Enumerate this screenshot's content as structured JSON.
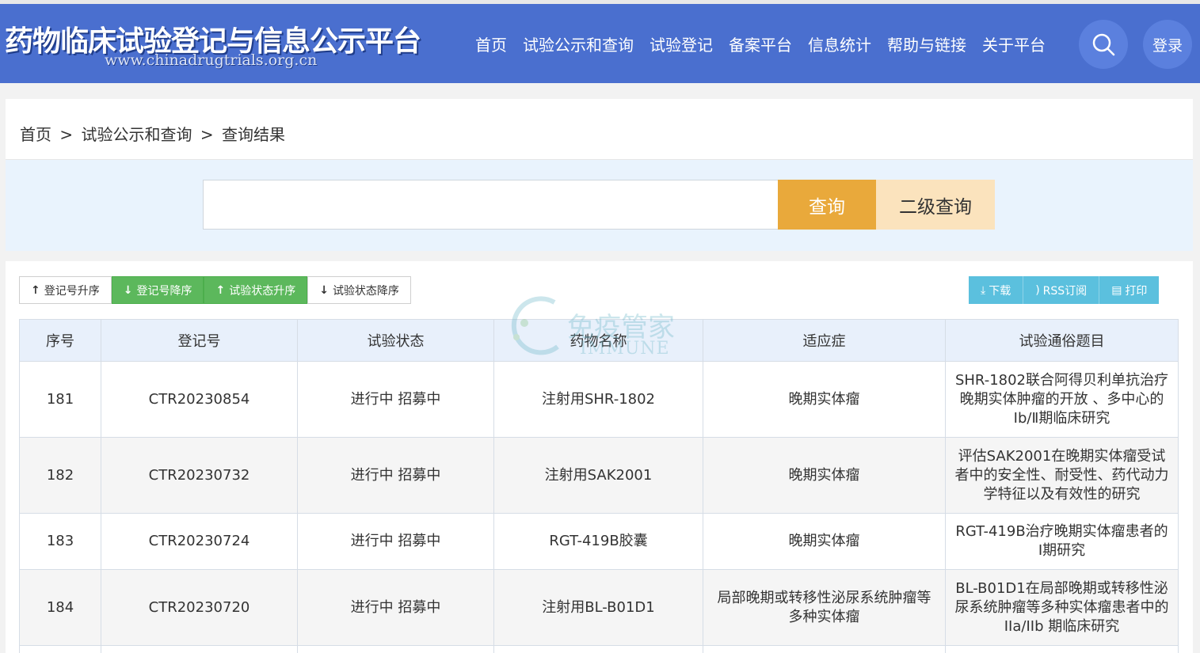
{
  "header": {
    "title": "药物临床试验登记与信息公示平台",
    "url": "www.chinadrugtrials.org.cn",
    "nav": [
      "首页",
      "试验公示和查询",
      "试验登记",
      "备案平台",
      "信息统计",
      "帮助与链接",
      "关于平台"
    ],
    "login_label": "登录"
  },
  "breadcrumb": {
    "items": [
      "首页",
      ">",
      "试验公示和查询",
      ">",
      "查询结果"
    ]
  },
  "search": {
    "value": "",
    "query_label": "查询",
    "secondary_label": "二级查询"
  },
  "sort": {
    "buttons": [
      {
        "arrow": "↑",
        "label": "登记号升序"
      },
      {
        "arrow": "↓",
        "label": "登记号降序"
      },
      {
        "arrow": "↑",
        "label": "试验状态升序"
      },
      {
        "arrow": "↓",
        "label": "试验状态降序"
      }
    ]
  },
  "tools": {
    "download": "下载",
    "rss": "RSS订阅",
    "print": "打印"
  },
  "table": {
    "headers": [
      "序号",
      "登记号",
      "试验状态",
      "药物名称",
      "适应症",
      "试验通俗题目"
    ],
    "rows": [
      [
        "181",
        "CTR20230854",
        "进行中 招募中",
        "注射用SHR-1802",
        "晚期实体瘤",
        "SHR-1802联合阿得贝利单抗治疗晚期实体肿瘤的开放 、多中心的Ⅰb/Ⅱ期临床研究"
      ],
      [
        "182",
        "CTR20230732",
        "进行中 招募中",
        "注射用SAK2001",
        "晚期实体瘤",
        "评估SAK2001在晚期实体瘤受试者中的安全性、耐受性、药代动力学特征以及有效性的研究"
      ],
      [
        "183",
        "CTR20230724",
        "进行中 招募中",
        "RGT-419B胶囊",
        "晚期实体瘤",
        "RGT-419B治疗晚期实体瘤患者的I期研究"
      ],
      [
        "184",
        "CTR20230720",
        "进行中 招募中",
        "注射用BL-B01D1",
        "局部晚期或转移性泌尿系统肿瘤等多种实体瘤",
        "BL-B01D1在局部晚期或转移性泌尿系统肿瘤等多种实体瘤患者中的IIa/IIb 期临床研究"
      ],
      [
        "",
        "",
        "",
        "",
        "",
        ""
      ]
    ]
  },
  "watermark": {
    "text": "免疫管家",
    "sub": "IMMUNE"
  },
  "colors": {
    "header_bg": "#4a6fcf",
    "query_btn": "#e9a93b",
    "secondary_btn": "#fbe3bd",
    "sort_active": "#5cb85c",
    "tool_btn": "#5bc0de"
  }
}
